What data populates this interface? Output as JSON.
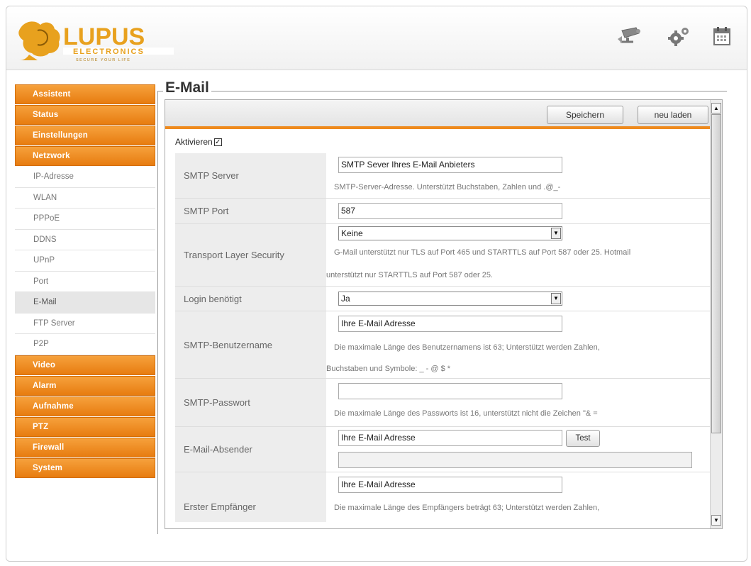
{
  "brand": {
    "name": "LUPUS",
    "sub": "ELECTRONICS",
    "tagline": "SECURE YOUR LIFE",
    "accent_color": "#ee8a1d",
    "text_color": "#e8a11e"
  },
  "header_icons": [
    "camera-icon",
    "gears-icon",
    "calendar-icon"
  ],
  "sidebar": {
    "top": [
      {
        "label": "Assistent"
      },
      {
        "label": "Status"
      },
      {
        "label": "Einstellungen"
      },
      {
        "label": "Netzwork"
      }
    ],
    "sub": [
      {
        "label": "IP-Adresse"
      },
      {
        "label": "WLAN"
      },
      {
        "label": "PPPoE"
      },
      {
        "label": "DDNS"
      },
      {
        "label": "UPnP"
      },
      {
        "label": "Port"
      },
      {
        "label": "E-Mail"
      },
      {
        "label": "FTP Server"
      },
      {
        "label": "P2P"
      }
    ],
    "bottom": [
      {
        "label": "Video"
      },
      {
        "label": "Alarm"
      },
      {
        "label": "Aufnahme"
      },
      {
        "label": "PTZ"
      },
      {
        "label": "Firewall"
      },
      {
        "label": "System"
      }
    ],
    "active_sub": "E-Mail"
  },
  "page": {
    "title": "E-Mail",
    "save_label": "Speichern",
    "reload_label": "neu laden",
    "activate_label": "Aktivieren",
    "activate_checked": true
  },
  "form": {
    "smtp_server": {
      "label": "SMTP Server",
      "value": "SMTP Sever Ihres E-Mail Anbieters",
      "hint": "SMTP-Server-Adresse. Unterstützt Buchstaben, Zahlen und .@_-"
    },
    "smtp_port": {
      "label": "SMTP Port",
      "value": "587"
    },
    "tls": {
      "label": "Transport Layer Security",
      "value": "Keine",
      "hint1": "G-Mail unterstützt nur TLS auf Port 465 und STARTTLS auf Port 587 oder 25. Hotmail",
      "hint2": "unterstützt nur STARTTLS auf Port 587 oder 25."
    },
    "login": {
      "label": "Login benötigt",
      "value": "Ja"
    },
    "username": {
      "label": "SMTP-Benutzername",
      "value": "Ihre E-Mail Adresse",
      "hint1": "Die maximale Länge des Benutzernamens ist 63; Unterstützt werden Zahlen,",
      "hint2": "Buchstaben und Symbole: _ - @ $ *"
    },
    "password": {
      "label": "SMTP-Passwort",
      "value": "",
      "hint": "Die maximale Länge des Passworts ist 16, unterstützt nicht die Zeichen \"& ="
    },
    "sender": {
      "label": "E-Mail-Absender",
      "value": "Ihre E-Mail Adresse",
      "test_label": "Test"
    },
    "recipient": {
      "label": "Erster Empfänger",
      "value": "Ihre E-Mail Adresse",
      "hint": "Die maximale Länge des Empfängers beträgt 63; Unterstützt werden Zahlen,"
    }
  }
}
